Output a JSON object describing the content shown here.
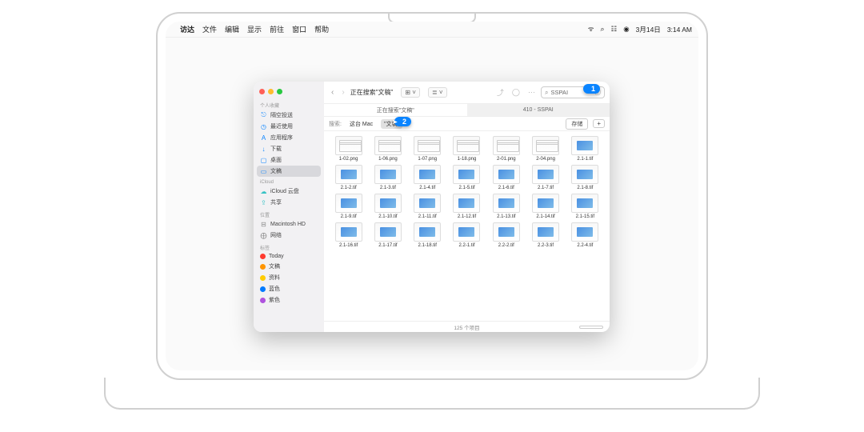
{
  "menubar": {
    "app": "访达",
    "items": [
      "文件",
      "编辑",
      "显示",
      "前往",
      "窗口",
      "帮助"
    ],
    "date": "3月14日",
    "time": "3:14 AM"
  },
  "finder": {
    "title": "正在搜索\"文稿\"",
    "tabs": {
      "active": "正在搜索\"文稿\"",
      "other": "410 - SSPAI"
    },
    "search_value": "SSPAI",
    "scope": {
      "label": "搜索:",
      "opt1": "这台 Mac",
      "opt2": "\"文稿\"",
      "save": "存储",
      "plus": "+"
    },
    "status": "125 个项目",
    "sidebar": {
      "sec1": "个人收藏",
      "items1": [
        {
          "icon": "⎋",
          "label": "隔空投送",
          "color": "#0a84ff"
        },
        {
          "icon": "◷",
          "label": "最近使用",
          "color": "#0a84ff"
        },
        {
          "icon": "A",
          "label": "应用程序",
          "color": "#0a84ff"
        },
        {
          "icon": "↓",
          "label": "下载",
          "color": "#0a84ff"
        },
        {
          "icon": "▢",
          "label": "桌面",
          "color": "#0a84ff"
        },
        {
          "icon": "▭",
          "label": "文稿",
          "color": "#0a84ff",
          "sel": true
        }
      ],
      "sec2": "iCloud",
      "items2": [
        {
          "icon": "☁",
          "label": "iCloud 云盘",
          "color": "#35c2c4"
        },
        {
          "icon": "⇪",
          "label": "共享",
          "color": "#35c2c4"
        }
      ],
      "sec3": "位置",
      "items3": [
        {
          "icon": "⊟",
          "label": "Macintosh HD",
          "color": "#888"
        },
        {
          "icon": "⨁",
          "label": "网络",
          "color": "#888"
        }
      ],
      "sec4": "标签",
      "tags": [
        {
          "color": "#ff3b30",
          "label": "Today"
        },
        {
          "color": "#ff9500",
          "label": "文稿"
        },
        {
          "color": "#ffcc00",
          "label": "资料"
        },
        {
          "color": "#007aff",
          "label": "蓝色"
        },
        {
          "color": "#af52de",
          "label": "紫色"
        }
      ]
    },
    "files": [
      {
        "name": "1-02.png",
        "t": "png"
      },
      {
        "name": "1-06.png",
        "t": "png"
      },
      {
        "name": "1-07.png",
        "t": "png"
      },
      {
        "name": "1-18.png",
        "t": "png"
      },
      {
        "name": "2-01.png",
        "t": "png"
      },
      {
        "name": "2-04.png",
        "t": "png"
      },
      {
        "name": "2.1-1.tif",
        "t": "tif"
      },
      {
        "name": "2.1-2.tif",
        "t": "tif"
      },
      {
        "name": "2.1-3.tif",
        "t": "tif"
      },
      {
        "name": "2.1-4.tif",
        "t": "tif"
      },
      {
        "name": "2.1-5.tif",
        "t": "tif"
      },
      {
        "name": "2.1-6.tif",
        "t": "tif"
      },
      {
        "name": "2.1-7.tif",
        "t": "tif"
      },
      {
        "name": "2.1-8.tif",
        "t": "tif"
      },
      {
        "name": "2.1-9.tif",
        "t": "tif"
      },
      {
        "name": "2.1-10.tif",
        "t": "tif"
      },
      {
        "name": "2.1-11.tif",
        "t": "tif"
      },
      {
        "name": "2.1-12.tif",
        "t": "tif"
      },
      {
        "name": "2.1-13.tif",
        "t": "tif"
      },
      {
        "name": "2.1-14.tif",
        "t": "tif"
      },
      {
        "name": "2.1-15.tif",
        "t": "tif"
      },
      {
        "name": "2.1-16.tif",
        "t": "tif"
      },
      {
        "name": "2.1-17.tif",
        "t": "tif"
      },
      {
        "name": "2.1-18.tif",
        "t": "tif"
      },
      {
        "name": "2.2-1.tif",
        "t": "tif"
      },
      {
        "name": "2.2-2.tif",
        "t": "tif"
      },
      {
        "name": "2.2-3.tif",
        "t": "tif"
      },
      {
        "name": "2.2-4.tif",
        "t": "tif"
      }
    ]
  },
  "callouts": {
    "one": "1",
    "two": "2"
  }
}
